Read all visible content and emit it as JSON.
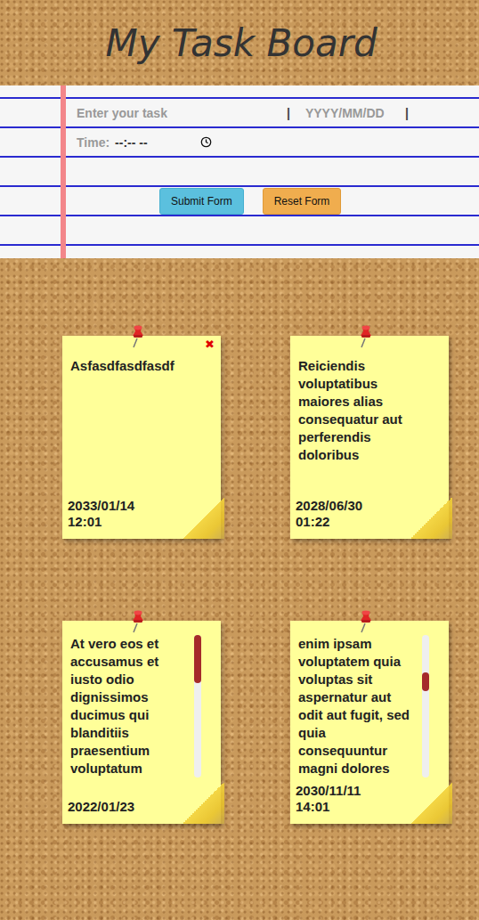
{
  "title": "My Task Board",
  "form": {
    "task_placeholder": "Enter your task",
    "separator": "|",
    "date_placeholder": "YYYY/MM/DD",
    "time_label": "Time:",
    "time_placeholder": "--:-- --",
    "buttons": [
      {
        "label": "Submit Form",
        "kind": "submit"
      },
      {
        "label": "Reset Form",
        "kind": "reset"
      }
    ]
  },
  "delete_icon": "✖",
  "notes": [
    {
      "text": "Asfasdfasdfasdf",
      "date": "2033/01/14",
      "time": "12:01",
      "delete_visible": true
    },
    {
      "text": "Reiciendis voluptatibus maiores alias consequatur aut perferendis doloribus",
      "date": "2028/06/30",
      "time": "01:22",
      "delete_visible": false
    },
    {
      "text": "At vero eos et accusamus et iusto odio dignissimos ducimus qui blanditiis praesentium voluptatum",
      "date": "2022/01/23",
      "delete_visible": false,
      "scrollbar": {
        "level": 0,
        "thumb_share": 0.34
      }
    },
    {
      "text": "enim ipsam voluptatem quia voluptas sit aspernatur aut odit aut fugit, sed quia consequuntur magni dolores",
      "date": "2030/11/11",
      "time": "14:01",
      "delete_visible": false,
      "scrollbar": {
        "level": 0.3,
        "thumb_share": 0.13
      }
    }
  ]
}
